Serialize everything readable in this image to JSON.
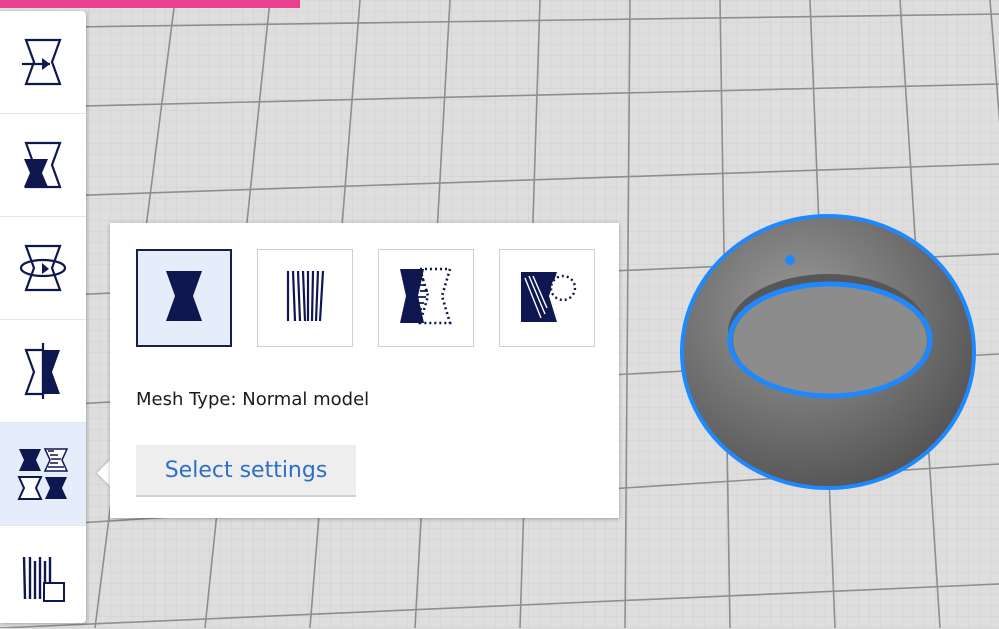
{
  "toolbar": {
    "tools": [
      {
        "icon": "move-icon"
      },
      {
        "icon": "scale-icon"
      },
      {
        "icon": "rotate-icon"
      },
      {
        "icon": "mirror-icon"
      },
      {
        "icon": "per-model-settings-icon",
        "active": true
      },
      {
        "icon": "support-blocker-icon"
      }
    ]
  },
  "mesh_panel": {
    "options": [
      {
        "name": "normal-model",
        "icon": "normal-model-icon",
        "selected": true
      },
      {
        "name": "print-as-support",
        "icon": "print-as-support-icon"
      },
      {
        "name": "modify-overlaps",
        "icon": "modify-overlaps-icon"
      },
      {
        "name": "dont-support-overlaps",
        "icon": "dont-support-overlaps-icon"
      }
    ],
    "mesh_type_text": "Mesh Type: Normal model",
    "select_settings_label": "Select settings"
  },
  "colors": {
    "accent_pink": "#e8418f",
    "icon_navy": "#0f1750",
    "link_blue": "#2d6fc7",
    "selection_outline": "#1e88ff",
    "model_gray": "#6e6e6e",
    "active_bg": "#e4edf9"
  }
}
